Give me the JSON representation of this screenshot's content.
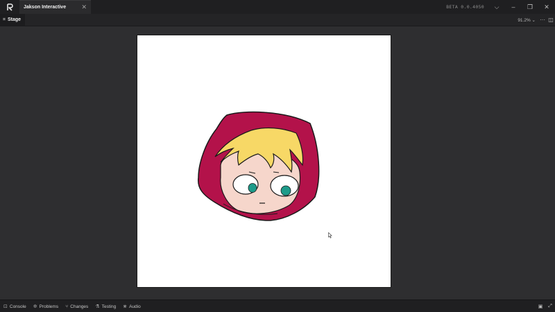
{
  "titlebar": {
    "logo_icon": "app-logo-icon",
    "tab_title": "Jakson Interactive",
    "close_symbol": "✕",
    "version": "BETA 0.0.4050",
    "chevron_symbol": "⌵",
    "minimize_symbol": "–",
    "restore_symbol": "❐",
    "close_window_symbol": "✕"
  },
  "panel": {
    "tab_icon": "⌗",
    "tab_label": "Stage",
    "zoom": "91.2% ⌄",
    "more_symbol": "···",
    "layout_symbol": "◫"
  },
  "stage": {
    "canvas_color": "#ffffff",
    "character": {
      "hood_color": "#b3124a",
      "hair_color": "#f7d866",
      "skin_color": "#f6d6cb",
      "eye_color": "#1e9b8a"
    }
  },
  "bottombar": {
    "items": [
      {
        "icon": "⊡",
        "label": "Console"
      },
      {
        "icon": "✲",
        "label": "Problems"
      },
      {
        "icon": "⑂",
        "label": "Changes"
      },
      {
        "icon": "⚗",
        "label": "Testing"
      },
      {
        "icon": "⋇",
        "label": "Audio"
      }
    ],
    "right_icon_1": "▣",
    "right_icon_2": "⤢"
  }
}
